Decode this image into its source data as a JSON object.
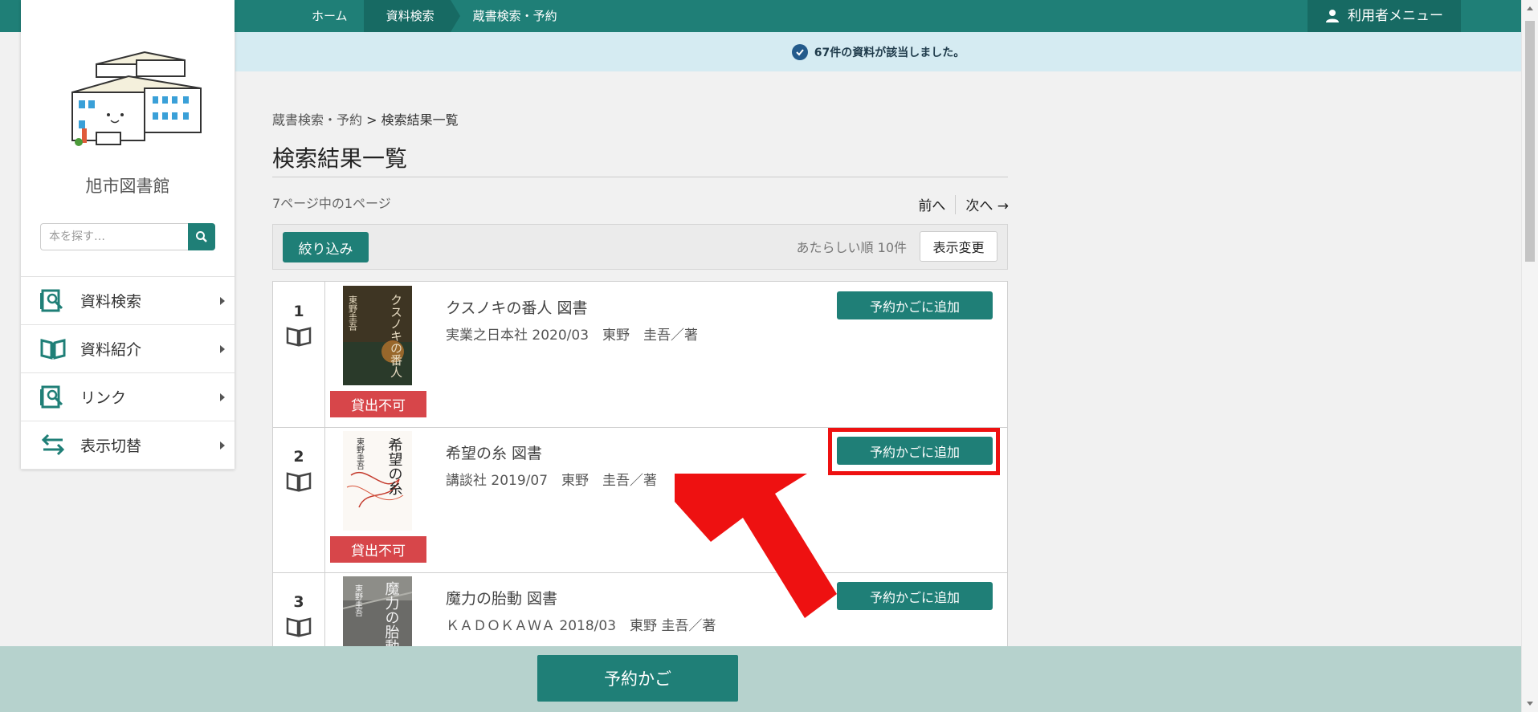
{
  "nav": {
    "crumbs": [
      "ホーム",
      "資料検索",
      "蔵書検索・予約"
    ],
    "user_menu": "利用者メニュー"
  },
  "notice": "67件の資料が該当しました。",
  "sidebar": {
    "library_name": "旭市図書館",
    "search_placeholder": "本を探す…",
    "items": [
      {
        "label": "資料検索",
        "icon": "search-book-icon"
      },
      {
        "label": "資料紹介",
        "icon": "open-book-icon"
      },
      {
        "label": "リンク",
        "icon": "search-book-icon"
      },
      {
        "label": "表示切替",
        "icon": "swap-arrows-icon"
      }
    ]
  },
  "main": {
    "breadcrumb_link": "蔵書検索・予約",
    "breadcrumb_sep": ">",
    "breadcrumb_current": "検索結果一覧",
    "title": "検索結果一覧",
    "page_info": "7ページ中の1ページ",
    "prev": "前へ",
    "next": "次へ →",
    "filter_button": "絞り込み",
    "sort_info": "あたらしい順 10件",
    "display_button": "表示変更"
  },
  "results": [
    {
      "num": "1",
      "title": "クスノキの番人 図書",
      "meta": "実業之日本社 2020/03　東野　圭吾／著",
      "badge": "貸出不可",
      "add": "予約かごに追加",
      "cover_title": "クスノキの番人",
      "cover_author": "東野圭吾"
    },
    {
      "num": "2",
      "title": "希望の糸 図書",
      "meta": "講談社 2019/07　東野　圭吾／著",
      "badge": "貸出不可",
      "add": "予約かごに追加",
      "cover_title": "希望の糸",
      "cover_author": "東野圭吾"
    },
    {
      "num": "3",
      "title": "魔力の胎動 図書",
      "meta": "ＫＡＤＯＫＡＷＡ 2018/03　東野 圭吾／著",
      "badge": "",
      "add": "予約かごに追加",
      "cover_title": "魔力の胎動",
      "cover_author": "東野圭吾"
    }
  ],
  "cart_button": "予約かご",
  "colors": {
    "accent": "#1f7f77",
    "danger": "#d7464a",
    "highlight": "#ee1111"
  }
}
